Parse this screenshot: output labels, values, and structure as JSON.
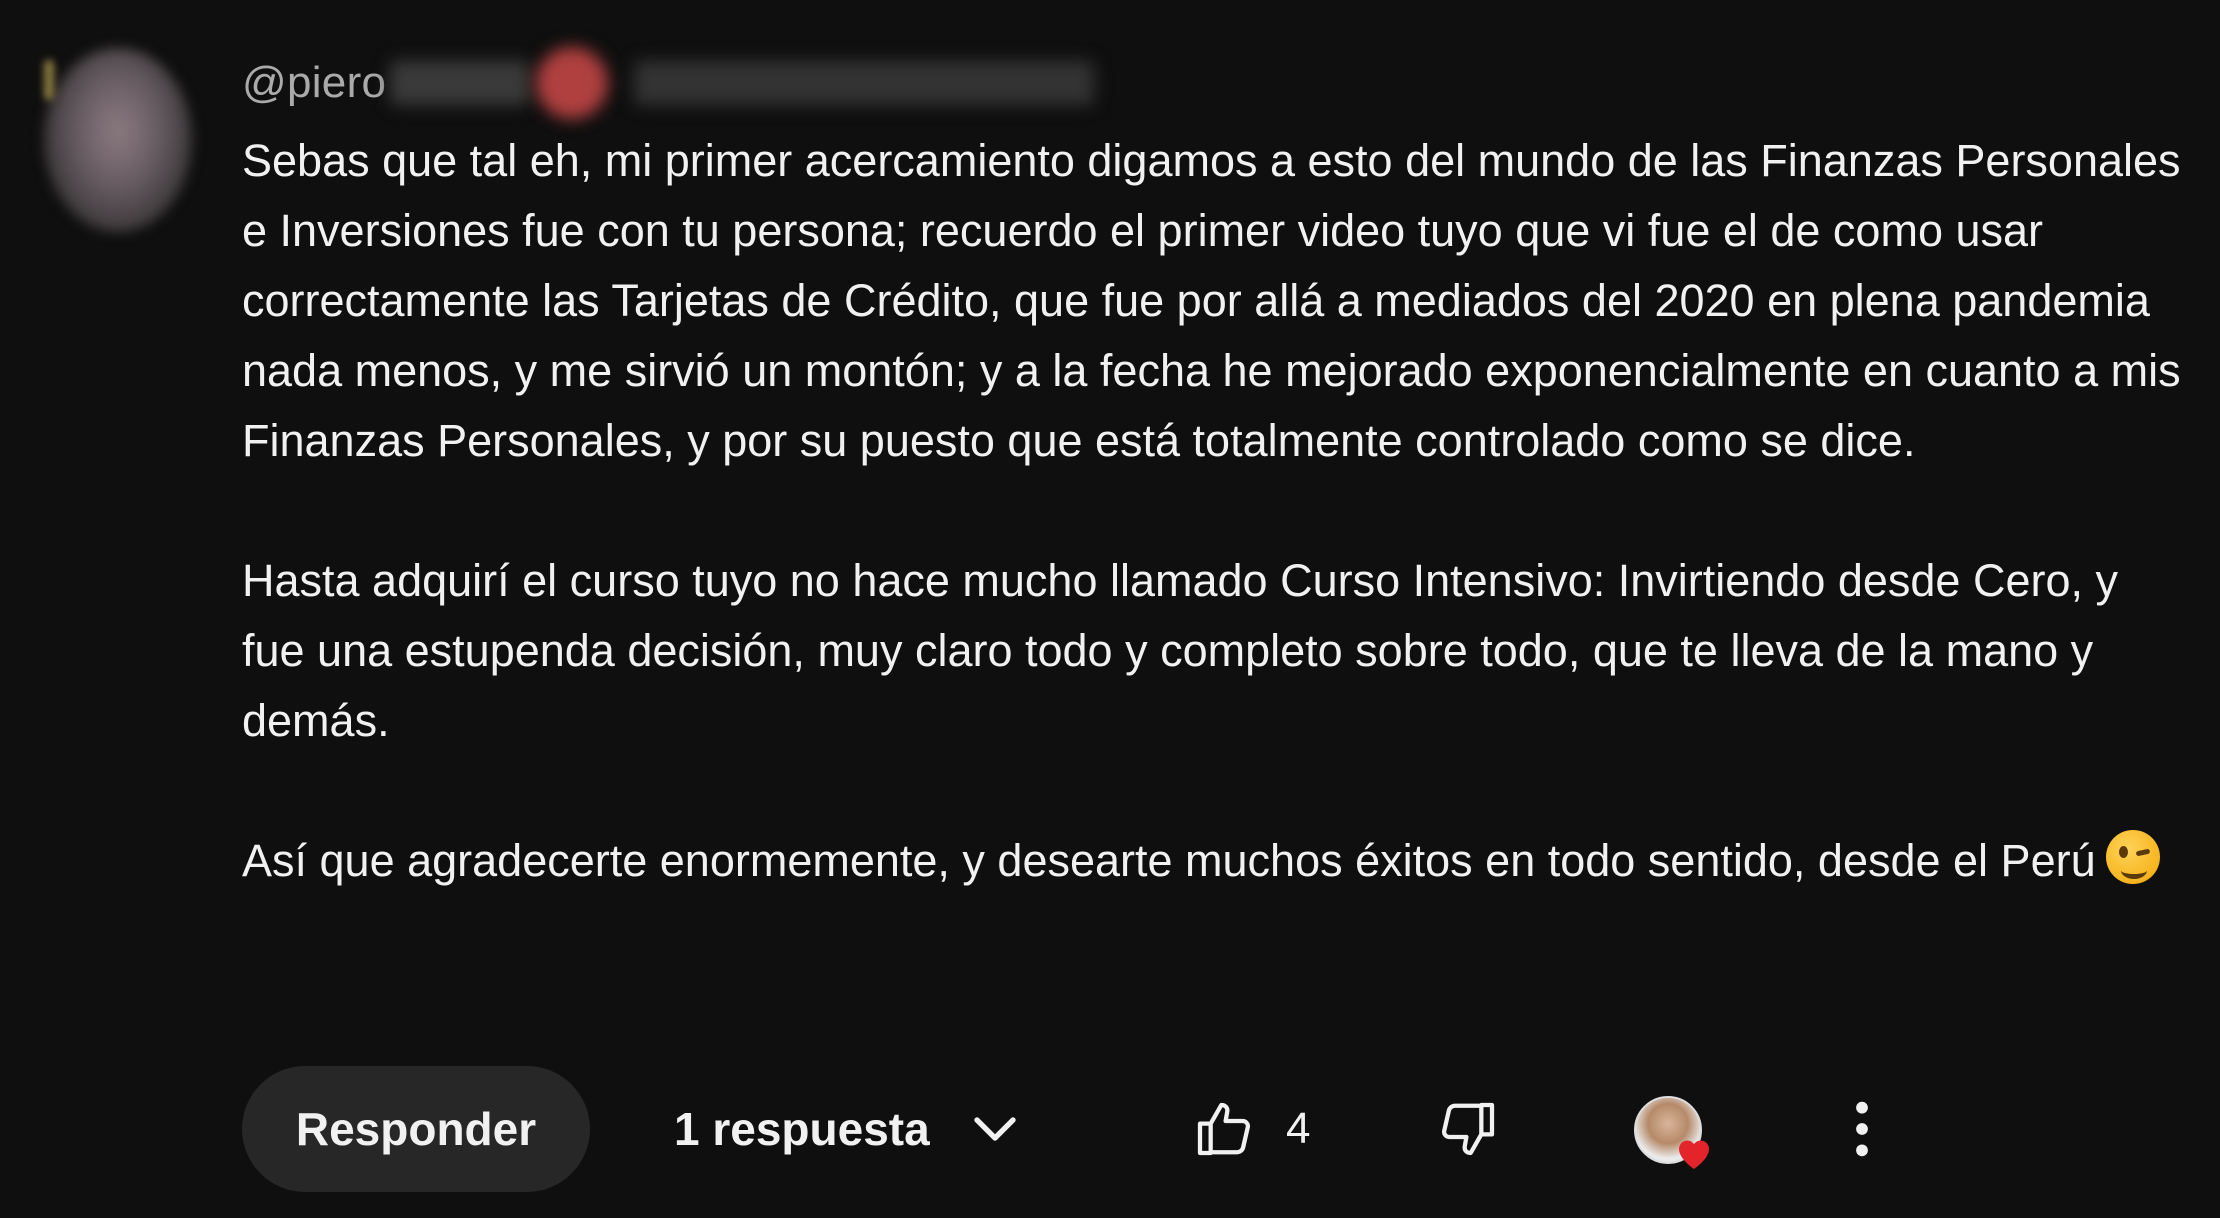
{
  "comment": {
    "handle": "@piero",
    "paragraphs": [
      "Sebas que tal eh, mi primer acercamiento digamos a esto del mundo de las Finanzas Personales e Inversiones fue con tu persona; recuerdo el primer video tuyo que vi fue el de como usar correctamente las Tarjetas de Crédito, que fue por allá a mediados del 2020 en plena pandemia nada menos, y me sirvió un montón; y a la fecha he mejorado exponencialmente en cuanto a mis Finanzas Personales, y por su puesto que está totalmente controlado como se dice.",
      "Hasta adquirí el curso tuyo no hace mucho llamado Curso Intensivo: Invirtiendo desde Cero, y fue una estupenda decisión, muy claro todo y completo sobre todo, que te lleva de la mano y demás.",
      "Así que agradecerte enormemente, y desearte muchos éxitos en todo sentido, desde el Perú"
    ],
    "emoji": "winking-face"
  },
  "actions": {
    "reply_label": "Responder",
    "replies_label": "1 respuesta",
    "like_count": "4"
  },
  "icons": {
    "replies_toggle": "chevron-down-icon",
    "like": "thumbs-up-icon",
    "dislike": "thumbs-down-icon",
    "creator_heart": "heart-icon",
    "more": "more-vert-icon"
  },
  "colors": {
    "background": "#0f0f0f",
    "text": "#f1f1f1",
    "secondary_text": "#aaaaaa",
    "button_bg": "#272727",
    "heart": "#e3242b"
  }
}
